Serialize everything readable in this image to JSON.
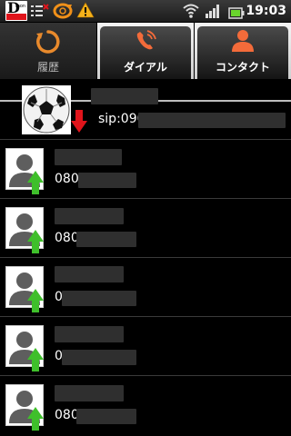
{
  "statusbar": {
    "dmon_letter": "D",
    "dmon_sub": "mon",
    "time": "19:03",
    "icons": [
      "dmon-icon",
      "notification-list-icon",
      "sync-icon",
      "warning-icon",
      "wifi-icon",
      "signal-icon",
      "battery-icon"
    ]
  },
  "tabs": [
    {
      "label": "履歴",
      "icon": "history-icon",
      "selected": true
    },
    {
      "label": "ダイアル",
      "icon": "dialer-icon",
      "selected": false
    },
    {
      "label": "コンタクト",
      "icon": "contacts-icon",
      "selected": false
    }
  ],
  "calls": [
    {
      "avatar": "soccer-ball-avatar",
      "direction": "incoming",
      "number_prefix": "sip:090"
    },
    {
      "avatar": "default-contact-avatar",
      "direction": "outgoing",
      "number_prefix": "0801"
    },
    {
      "avatar": "default-contact-avatar",
      "direction": "outgoing",
      "number_prefix": "080"
    },
    {
      "avatar": "default-contact-avatar",
      "direction": "outgoing",
      "number_prefix": "0"
    },
    {
      "avatar": "default-contact-avatar",
      "direction": "outgoing",
      "number_prefix": "0"
    },
    {
      "avatar": "default-contact-avatar",
      "direction": "outgoing",
      "number_prefix": "080"
    }
  ],
  "colors": {
    "incoming_arrow": "#e0141b",
    "outgoing_arrow": "#3fbf2b",
    "background": "#000000"
  }
}
